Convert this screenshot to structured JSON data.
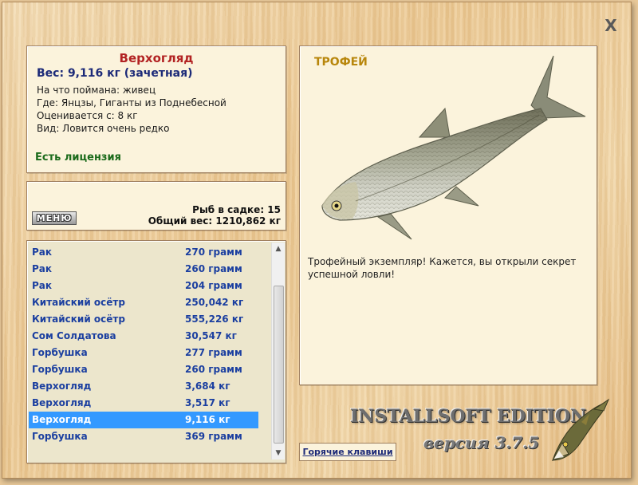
{
  "window": {
    "close_label": "X"
  },
  "info": {
    "name": "Верхогляд",
    "weight": "Вес: 9,116 кг (зачетная)",
    "caught_on": "На что поймана: живец",
    "where": "Где: Янцзы, Гиганты из Поднебесной",
    "valued_from": "Оценивается с: 8 кг",
    "kind": "Вид: Ловится очень редко",
    "license": "Есть лицензия"
  },
  "mid": {
    "menu_label": "МЕНЮ",
    "fish_in_net": "Рыб в садке: 15",
    "total_weight": "Общий вес: 1210,862 кг"
  },
  "catch_list": [
    {
      "name": "Рак",
      "weight": "270 грамм"
    },
    {
      "name": "Рак",
      "weight": "260 грамм"
    },
    {
      "name": "Рак",
      "weight": "204 грамм"
    },
    {
      "name": "Китайский осётр",
      "weight": "250,042 кг"
    },
    {
      "name": "Китайский осётр",
      "weight": "555,226 кг"
    },
    {
      "name": "Сом Солдатова",
      "weight": "30,547 кг"
    },
    {
      "name": "Горбушка",
      "weight": "277 грамм"
    },
    {
      "name": "Горбушка",
      "weight": "260 грамм"
    },
    {
      "name": "Верхогляд",
      "weight": "3,684 кг"
    },
    {
      "name": "Верхогляд",
      "weight": "3,517 кг"
    },
    {
      "name": "Верхогляд",
      "weight": "9,116 кг",
      "selected": true
    },
    {
      "name": "Горбушка",
      "weight": "369 грамм"
    }
  ],
  "trophy": {
    "title": "ТРОФЕЙ",
    "message": "Трофейный экземпляр! Кажется, вы открыли секрет успешной ловли!"
  },
  "footer": {
    "hotkeys_label": "Горячие клавиши",
    "brand": "INSTALLSOFT EDITION",
    "version": "версия 3.7.5"
  },
  "colors": {
    "fish_name": "#b22222",
    "weight_text": "#1c2a78",
    "license": "#1a6a1a",
    "list_text": "#1b3fa0",
    "selection": "#3399ff",
    "trophy_title": "#b8860b"
  }
}
